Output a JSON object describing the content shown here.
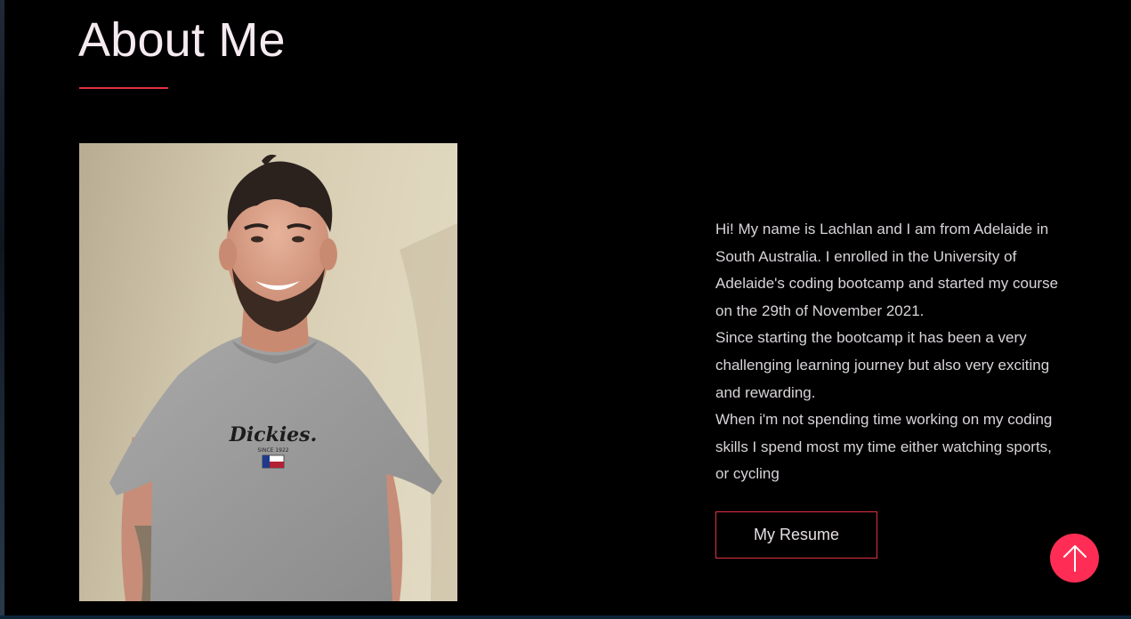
{
  "section": {
    "title": "About Me"
  },
  "profile_photo": {
    "alt": "Portrait of Lachlan smiling in a grey t-shirt",
    "shirt_logo": "Dickies.",
    "shirt_logo_sub": "SINCE 1922"
  },
  "bio": {
    "paragraphs": [
      "Hi! My name is Lachlan and I am from Adelaide in South Australia. I enrolled in the University of Adelaide's coding bootcamp and started my course on the 29th of November 2021.",
      "Since starting the bootcamp it has been a very challenging learning journey but also very exciting and rewarding.",
      "When i'm not spending time working on my coding skills I spend most my time either watching sports, or cycling"
    ]
  },
  "buttons": {
    "resume_label": "My Resume",
    "back_to_top_icon": "arrow-up-icon"
  },
  "colors": {
    "accent": "#e0323f",
    "back_to_top_bg": "#ff2d55",
    "background": "#000000"
  }
}
